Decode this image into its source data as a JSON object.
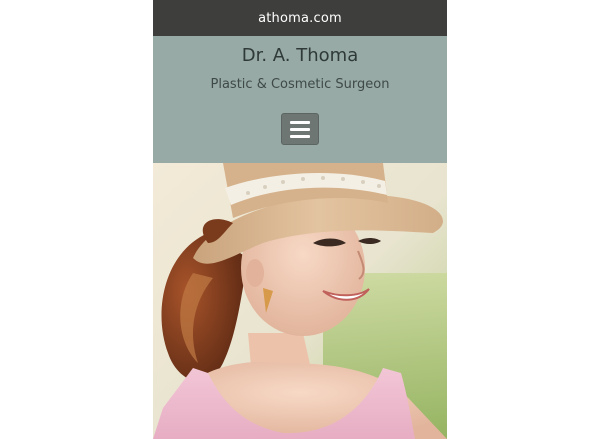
{
  "browser": {
    "url": "athoma.com"
  },
  "header": {
    "title": "Dr. A. Thoma",
    "tagline": "Plastic & Cosmetic Surgeon",
    "menu_icon": "hamburger-menu-icon"
  },
  "hero": {
    "subject": "woman-in-sun-hat"
  },
  "colors": {
    "url_bar_bg": "#3e3f3d",
    "header_bg": "#97aaa5",
    "menu_button_bg": "#6d7673"
  }
}
